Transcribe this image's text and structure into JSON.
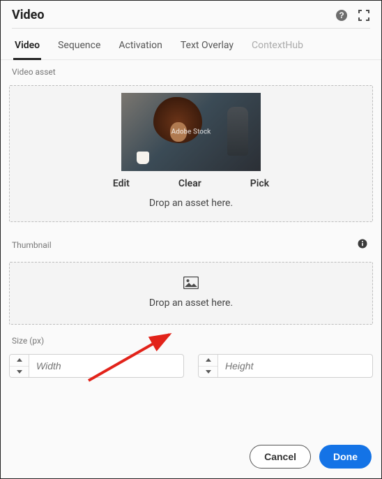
{
  "header": {
    "title": "Video"
  },
  "tabs": [
    {
      "label": "Video",
      "state": "active"
    },
    {
      "label": "Sequence",
      "state": "normal"
    },
    {
      "label": "Activation",
      "state": "normal"
    },
    {
      "label": "Text Overlay",
      "state": "normal"
    },
    {
      "label": "ContextHub",
      "state": "disabled"
    }
  ],
  "video_asset": {
    "label": "Video asset",
    "watermark": "Adobe Stock",
    "actions": {
      "edit": "Edit",
      "clear": "Clear",
      "pick": "Pick"
    },
    "drop_hint": "Drop an asset here."
  },
  "thumbnail": {
    "label": "Thumbnail",
    "drop_hint": "Drop an asset here."
  },
  "size": {
    "label": "Size (px)",
    "width_placeholder": "Width",
    "height_placeholder": "Height",
    "width_value": "",
    "height_value": ""
  },
  "footer": {
    "cancel": "Cancel",
    "done": "Done"
  }
}
